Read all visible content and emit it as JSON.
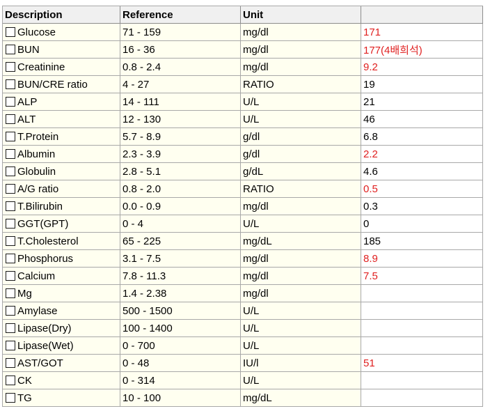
{
  "header": {
    "description": "Description",
    "reference": "Reference",
    "unit": "Unit",
    "value": ""
  },
  "colors": {
    "abnormal": "#e02020",
    "normal": "#000000",
    "row_background": "#fffff0",
    "header_background": "#f0f0f0"
  },
  "rows": [
    {
      "description": "Glucose",
      "reference": "71 - 159",
      "unit": "mg/dl",
      "value": "171",
      "flag": "abnormal",
      "checked": false
    },
    {
      "description": "BUN",
      "reference": "16 - 36",
      "unit": "mg/dl",
      "value": "177(4배희석)",
      "flag": "abnormal",
      "checked": false
    },
    {
      "description": "Creatinine",
      "reference": "0.8 - 2.4",
      "unit": "mg/dl",
      "value": "9.2",
      "flag": "abnormal",
      "checked": false
    },
    {
      "description": "BUN/CRE ratio",
      "reference": "4 - 27",
      "unit": "RATIO",
      "value": "19",
      "flag": "normal",
      "checked": false
    },
    {
      "description": "ALP",
      "reference": "14 - 111",
      "unit": "U/L",
      "value": "21",
      "flag": "normal",
      "checked": false
    },
    {
      "description": "ALT",
      "reference": "12 - 130",
      "unit": "U/L",
      "value": "46",
      "flag": "normal",
      "checked": false
    },
    {
      "description": "T.Protein",
      "reference": "5.7 - 8.9",
      "unit": "g/dl",
      "value": "6.8",
      "flag": "normal",
      "checked": false
    },
    {
      "description": "Albumin",
      "reference": "2.3 - 3.9",
      "unit": "g/dl",
      "value": "2.2",
      "flag": "abnormal",
      "checked": false
    },
    {
      "description": "Globulin",
      "reference": "2.8 - 5.1",
      "unit": "g/dL",
      "value": "4.6",
      "flag": "normal",
      "checked": false
    },
    {
      "description": "A/G ratio",
      "reference": "0.8 - 2.0",
      "unit": "RATIO",
      "value": "0.5",
      "flag": "abnormal",
      "checked": false
    },
    {
      "description": "T.Bilirubin",
      "reference": "0.0 - 0.9",
      "unit": "mg/dl",
      "value": "0.3",
      "flag": "normal",
      "checked": false
    },
    {
      "description": "GGT(GPT)",
      "reference": "0 - 4",
      "unit": "U/L",
      "value": "0",
      "flag": "normal",
      "checked": false
    },
    {
      "description": "T.Cholesterol",
      "reference": "65 - 225",
      "unit": "mg/dL",
      "value": "185",
      "flag": "normal",
      "checked": false
    },
    {
      "description": "Phosphorus",
      "reference": "3.1 - 7.5",
      "unit": "mg/dl",
      "value": "8.9",
      "flag": "abnormal",
      "checked": false
    },
    {
      "description": "Calcium",
      "reference": "7.8 - 11.3",
      "unit": "mg/dl",
      "value": "7.5",
      "flag": "abnormal",
      "checked": false
    },
    {
      "description": "Mg",
      "reference": "1.4 - 2.38",
      "unit": "mg/dl",
      "value": "",
      "flag": "normal",
      "checked": false
    },
    {
      "description": "Amylase",
      "reference": "500 - 1500",
      "unit": "U/L",
      "value": "",
      "flag": "normal",
      "checked": false
    },
    {
      "description": "Lipase(Dry)",
      "reference": "100 - 1400",
      "unit": "U/L",
      "value": "",
      "flag": "normal",
      "checked": false
    },
    {
      "description": "Lipase(Wet)",
      "reference": "0 - 700",
      "unit": "U/L",
      "value": "",
      "flag": "normal",
      "checked": false
    },
    {
      "description": "AST/GOT",
      "reference": "0 - 48",
      "unit": "IU/l",
      "value": "51",
      "flag": "abnormal",
      "checked": false
    },
    {
      "description": "CK",
      "reference": "0 - 314",
      "unit": "U/L",
      "value": "",
      "flag": "normal",
      "checked": false
    },
    {
      "description": "TG",
      "reference": "10 - 100",
      "unit": "mg/dL",
      "value": "",
      "flag": "normal",
      "checked": false
    }
  ]
}
